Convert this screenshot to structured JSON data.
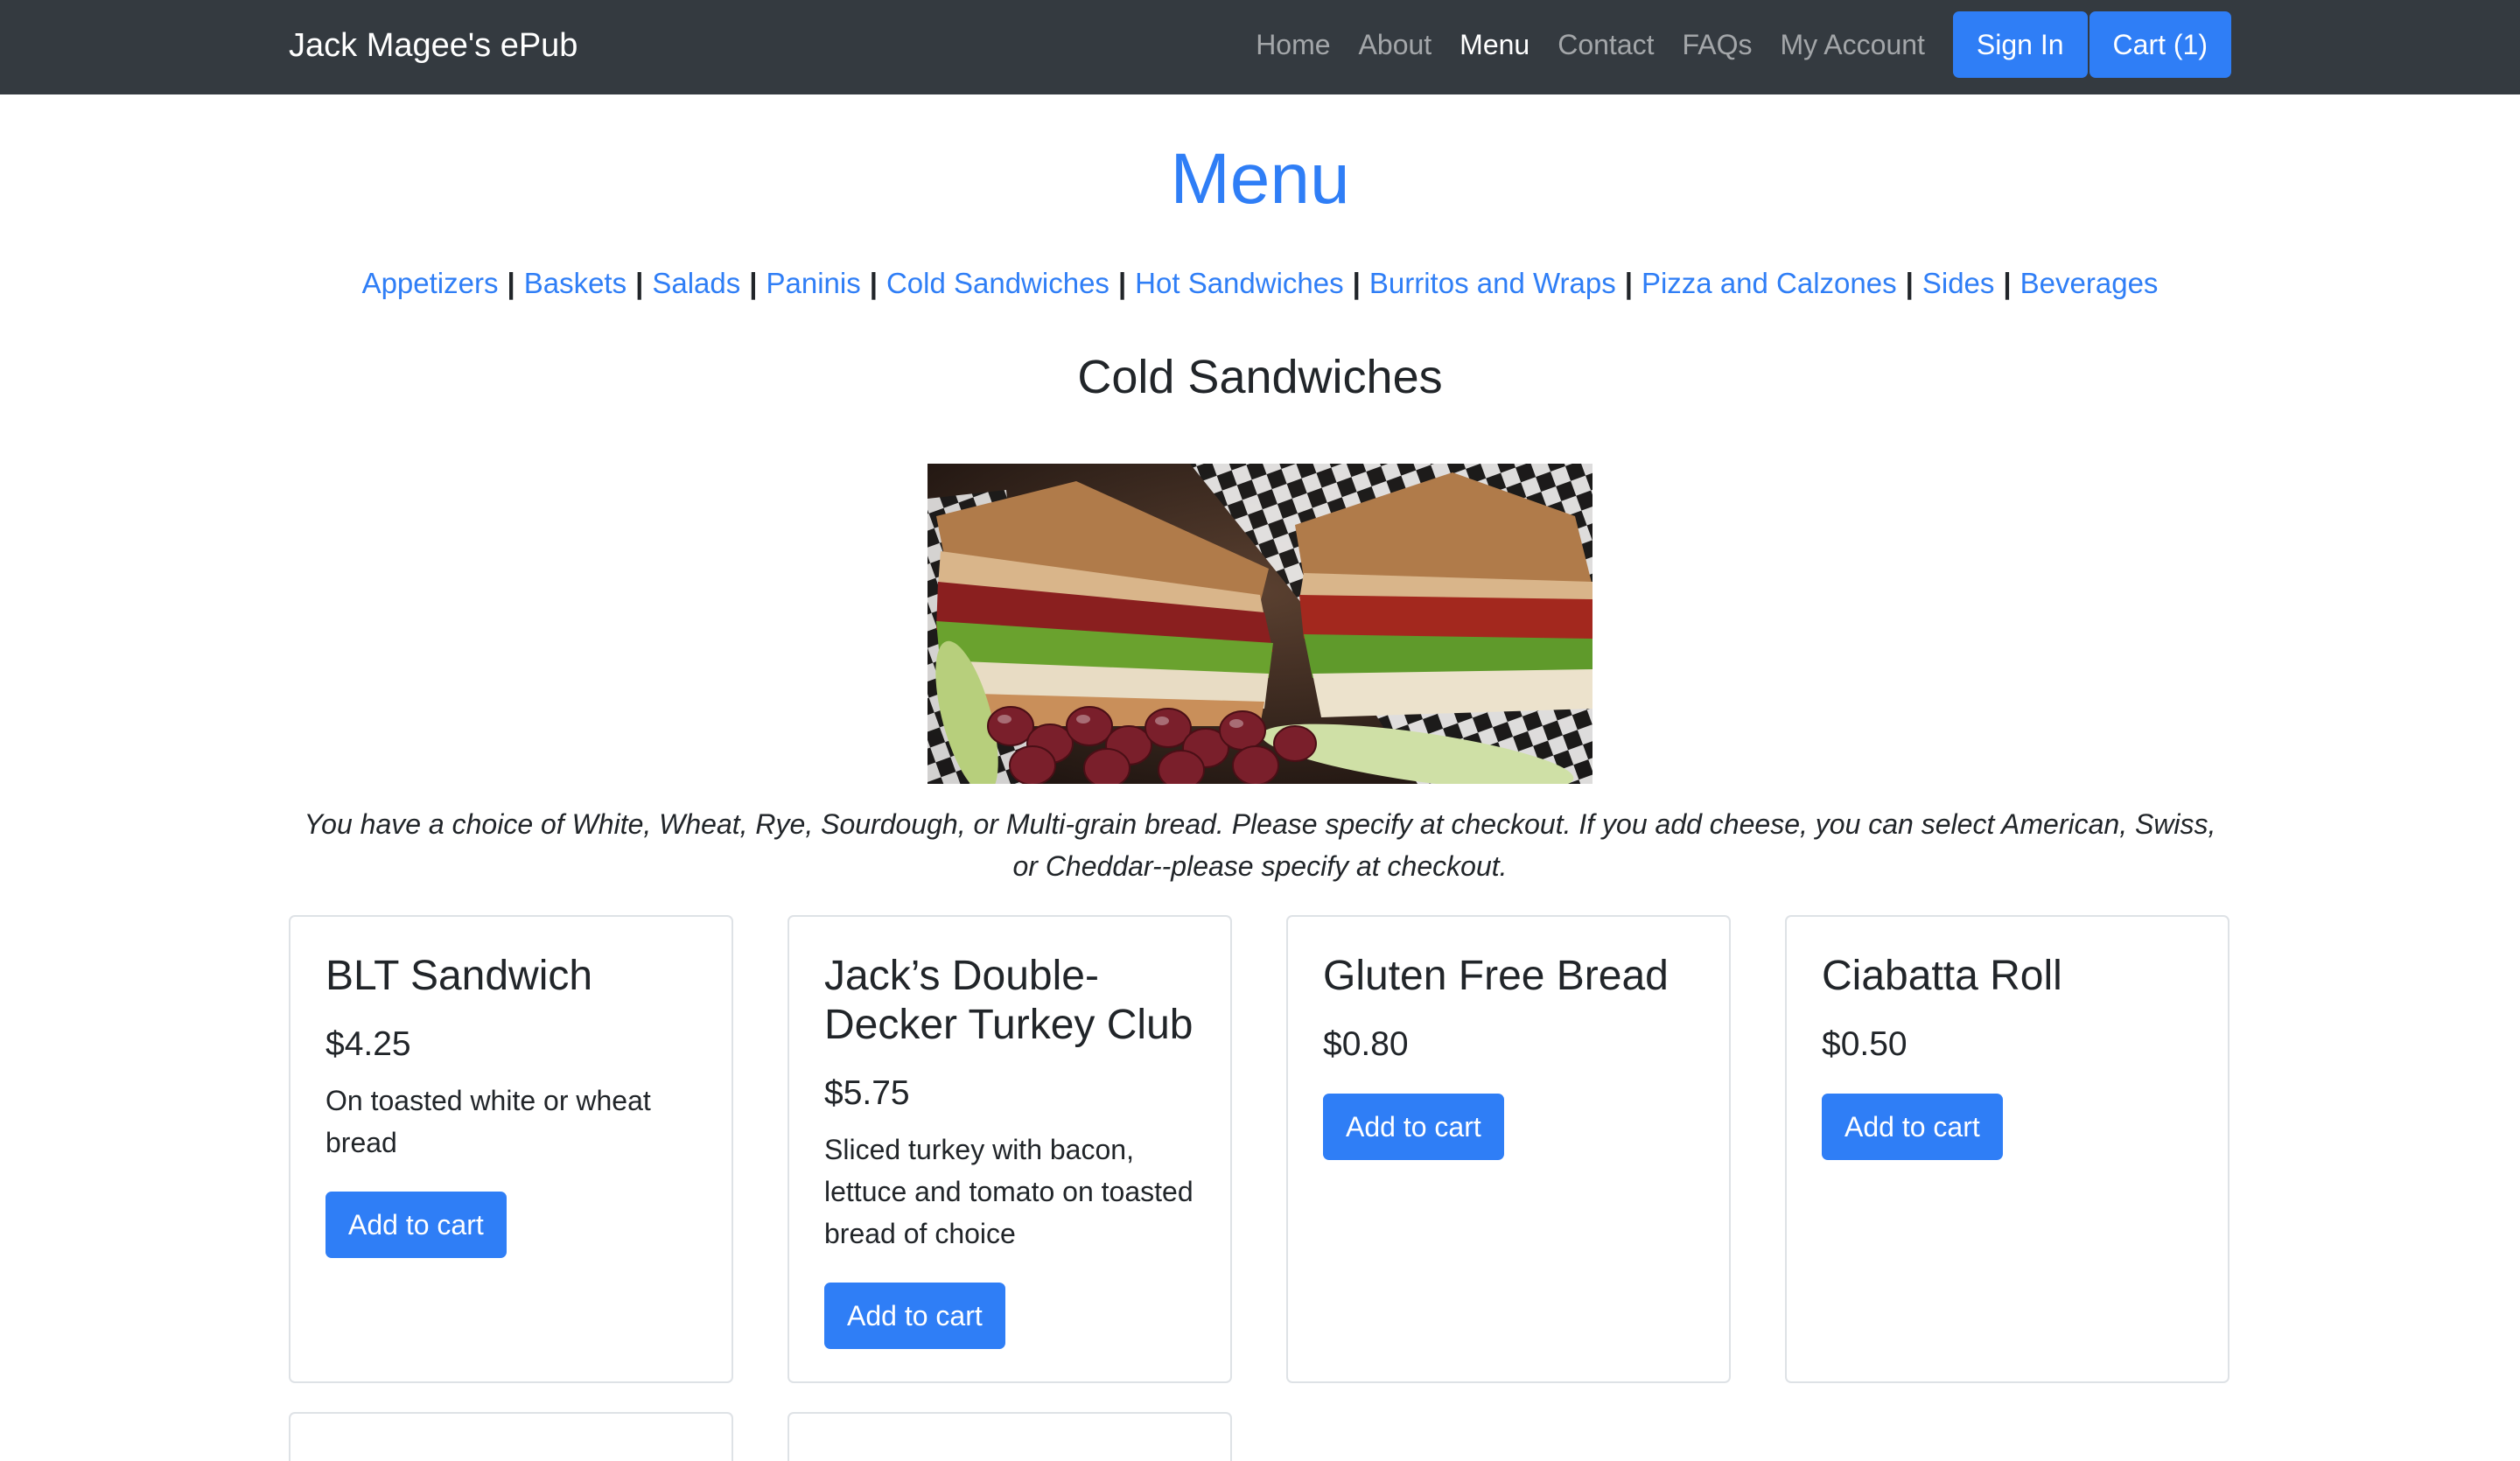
{
  "navbar": {
    "brand": "Jack Magee's ePub",
    "links": [
      "Home",
      "About",
      "Menu",
      "Contact",
      "FAQs",
      "My Account"
    ],
    "active_link": "Menu",
    "sign_in": "Sign In",
    "cart": "Cart (1)"
  },
  "page": {
    "title": "Menu",
    "categories": [
      "Appetizers",
      "Baskets",
      "Salads",
      "Paninis",
      "Cold Sandwiches",
      "Hot Sandwiches",
      "Burritos and Wraps",
      "Pizza and Calzones",
      "Sides",
      "Beverages"
    ],
    "separator": "|",
    "section_title": "Cold Sandwiches",
    "note": "You have a choice of White, Wheat, Rye, Sourdough, or Multi-grain bread. Please specify at checkout. If you add cheese, you can select American, Swiss, or Cheddar--please specify at checkout."
  },
  "items": [
    {
      "name": "BLT Sandwich",
      "price": "$4.25",
      "description": "On toasted white or wheat bread",
      "button": "Add to cart"
    },
    {
      "name": "Jack’s Double-Decker Turkey Club",
      "price": "$5.75",
      "description": "Sliced turkey with bacon, lettuce and tomato on toasted bread of choice",
      "button": "Add to cart"
    },
    {
      "name": "Gluten Free Bread",
      "price": "$0.80",
      "description": "",
      "button": "Add to cart"
    },
    {
      "name": "Ciabatta Roll",
      "price": "$0.50",
      "description": "",
      "button": "Add to cart"
    }
  ],
  "colors": {
    "navbar": "#343a40",
    "accent": "#2f7ef6",
    "text": "#212529"
  }
}
